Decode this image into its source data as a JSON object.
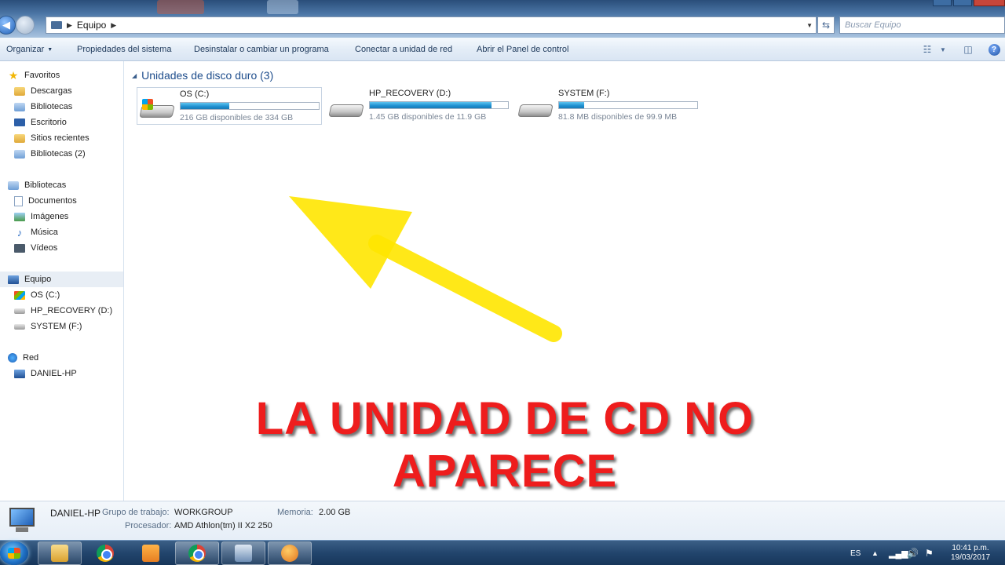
{
  "window": {
    "address_crumb": "Equipo",
    "search_placeholder": "Buscar Equipo"
  },
  "toolbar": {
    "organize": "Organizar",
    "system_properties": "Propiedades del sistema",
    "uninstall": "Desinstalar o cambiar un programa",
    "map_drive": "Conectar a unidad de red",
    "control_panel": "Abrir el Panel de control"
  },
  "sidebar": {
    "favorites": {
      "label": "Favoritos",
      "items": [
        {
          "label": "Descargas",
          "icon": "downloads-folder-icon"
        },
        {
          "label": "Bibliotecas",
          "icon": "libraries-icon"
        },
        {
          "label": "Escritorio",
          "icon": "desktop-icon"
        },
        {
          "label": "Sitios recientes",
          "icon": "recent-places-icon"
        },
        {
          "label": "Bibliotecas (2)",
          "icon": "libraries-icon"
        }
      ]
    },
    "libraries": {
      "label": "Bibliotecas",
      "items": [
        {
          "label": "Documentos",
          "icon": "documents-icon"
        },
        {
          "label": "Imágenes",
          "icon": "pictures-icon"
        },
        {
          "label": "Música",
          "icon": "music-icon"
        },
        {
          "label": "Vídeos",
          "icon": "videos-icon"
        }
      ]
    },
    "computer": {
      "label": "Equipo",
      "items": [
        {
          "label": "OS (C:)",
          "icon": "os-drive-icon"
        },
        {
          "label": "HP_RECOVERY (D:)",
          "icon": "drive-icon"
        },
        {
          "label": "SYSTEM (F:)",
          "icon": "drive-icon"
        }
      ]
    },
    "network": {
      "label": "Red",
      "items": [
        {
          "label": "DANIEL-HP",
          "icon": "computer-icon"
        }
      ]
    }
  },
  "main": {
    "group_title": "Unidades de disco duro (3)",
    "drives": [
      {
        "name": "OS (C:)",
        "free_text": "216 GB disponibles de 334 GB",
        "used_fraction": 0.35,
        "os": true
      },
      {
        "name": "HP_RECOVERY (D:)",
        "free_text": "1.45 GB disponibles de 11.9 GB",
        "used_fraction": 0.88,
        "os": false
      },
      {
        "name": "SYSTEM (F:)",
        "free_text": "81.8 MB disponibles de 99.9 MB",
        "used_fraction": 0.18,
        "os": false
      }
    ]
  },
  "annotation": {
    "caption": "LA UNIDAD DE CD NO APARECE",
    "arrow_color": "#ffe600",
    "caption_color": "#ee1d1d"
  },
  "details": {
    "computer_name": "DANIEL-HP",
    "workgroup_label": "Grupo de trabajo:",
    "workgroup_value": "WORKGROUP",
    "memory_label": "Memoria:",
    "memory_value": "2.00 GB",
    "processor_label": "Procesador:",
    "processor_value": "AMD Athlon(tm) II X2 250"
  },
  "taskbar": {
    "language": "ES",
    "time": "10:41 p.m.",
    "date": "19/03/2017"
  }
}
